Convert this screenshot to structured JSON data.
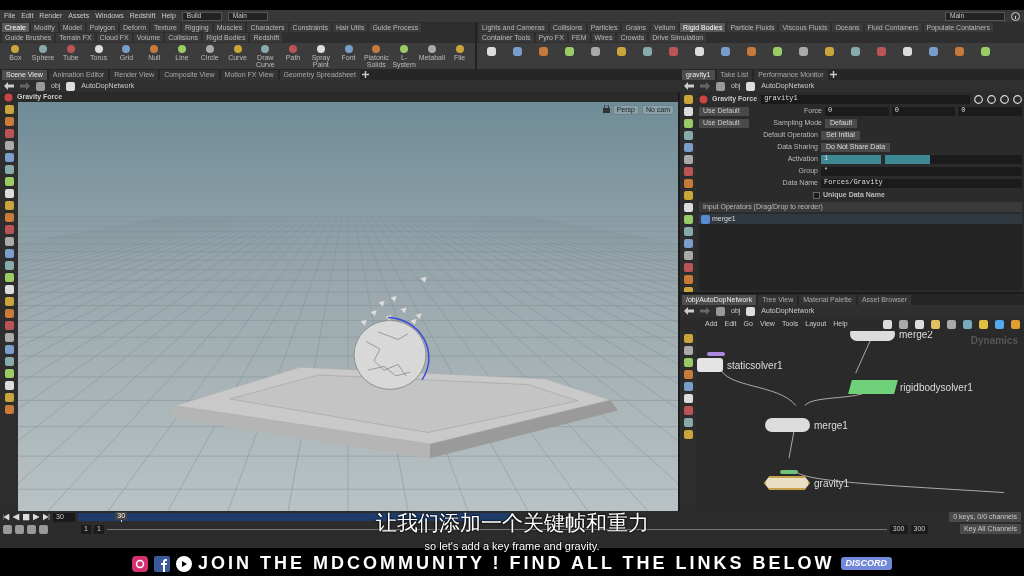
{
  "menu": [
    "File",
    "Edit",
    "Render",
    "Assets",
    "Windows",
    "Redshift",
    "Help"
  ],
  "desktop": "Build",
  "workspace": "Main",
  "main_field": "Main",
  "shelf_left": {
    "tabs": [
      {
        "label": "Create",
        "selected": true
      },
      {
        "label": "Modify",
        "selected": false
      },
      {
        "label": "Model",
        "selected": false
      },
      {
        "label": "Polygon",
        "selected": false
      },
      {
        "label": "Deform",
        "selected": false
      },
      {
        "label": "Texture",
        "selected": false
      },
      {
        "label": "Rigging",
        "selected": false
      },
      {
        "label": "Muscles",
        "selected": false
      },
      {
        "label": "Characters",
        "selected": false
      },
      {
        "label": "Constraints",
        "selected": false
      },
      {
        "label": "Hair Utils",
        "selected": false
      },
      {
        "label": "Guide Process",
        "selected": false
      },
      {
        "label": "Guide Brushes",
        "selected": false
      },
      {
        "label": "Terrain FX",
        "selected": false
      },
      {
        "label": "Cloud FX",
        "selected": false
      },
      {
        "label": "Volume",
        "selected": false
      },
      {
        "label": "Collisions",
        "selected": false
      },
      {
        "label": "Rigid Bodies",
        "selected": false
      },
      {
        "label": "Redshift",
        "selected": false
      }
    ],
    "tools": [
      "Box",
      "Sphere",
      "Tube",
      "Torus",
      "Grid",
      "Null",
      "Line",
      "Circle",
      "Curve",
      "Draw Curve",
      "Path",
      "Spray Paint",
      "Font",
      "Platonic Solids",
      "L-System",
      "Metaball",
      "File"
    ]
  },
  "shelf_right": {
    "tabs": [
      {
        "label": "Lights and Cameras",
        "selected": false
      },
      {
        "label": "Collisions",
        "selected": false
      },
      {
        "label": "Particles",
        "selected": false
      },
      {
        "label": "Grains",
        "selected": false
      },
      {
        "label": "Vellum",
        "selected": false
      },
      {
        "label": "Rigid Bodies",
        "selected": true
      },
      {
        "label": "Particle Fluids",
        "selected": false
      },
      {
        "label": "Viscous Fluids",
        "selected": false
      },
      {
        "label": "Oceans",
        "selected": false
      },
      {
        "label": "Fluid Containers",
        "selected": false
      },
      {
        "label": "Populate Containers",
        "selected": false
      },
      {
        "label": "Container Tools",
        "selected": false
      },
      {
        "label": "Pyro FX",
        "selected": false
      },
      {
        "label": "FEM",
        "selected": false
      },
      {
        "label": "Wires",
        "selected": false
      },
      {
        "label": "Crowds",
        "selected": false
      },
      {
        "label": "Drive Simulation",
        "selected": false
      }
    ]
  },
  "pane_tabs_left": [
    {
      "label": "Scene View",
      "selected": true
    },
    {
      "label": "Animation Editor",
      "selected": false
    },
    {
      "label": "Render View",
      "selected": false
    },
    {
      "label": "Composite View",
      "selected": false
    },
    {
      "label": "Motion FX View",
      "selected": false
    },
    {
      "label": "Geometry Spreadsheet",
      "selected": false
    }
  ],
  "pane_tabs_right": [
    {
      "label": "gravity1",
      "selected": true
    },
    {
      "label": "Take List",
      "selected": false
    },
    {
      "label": "Performance Monitor",
      "selected": false
    }
  ],
  "path_left": [
    "obj",
    "AutoDopNetwork"
  ],
  "path_right": [
    "obj",
    "AutoDopNetwork"
  ],
  "viewport": {
    "title": "Gravity Force",
    "camera_buttons": [
      "Persp",
      "No cam"
    ]
  },
  "parameters": {
    "node_type": "Gravity Force",
    "node_name": "gravity1",
    "rows": [
      {
        "kind": "vector",
        "default_button": "Use Default",
        "label": "Force",
        "values": [
          "0",
          "0",
          "0"
        ]
      },
      {
        "kind": "menu",
        "default_button": "Use Default",
        "label": "Sampling Mode",
        "value": "Default"
      },
      {
        "kind": "menu",
        "label": "Default Operation",
        "value": "Set Initial"
      },
      {
        "kind": "menu",
        "label": "Data Sharing",
        "value": "Do Not Share Data"
      },
      {
        "kind": "slider",
        "label": "Activation",
        "value": "1",
        "level": 0.33
      },
      {
        "kind": "text",
        "label": "Group",
        "value": "*"
      },
      {
        "kind": "text",
        "label": "Data Name",
        "value": "Forces/Gravity"
      },
      {
        "kind": "checkbox",
        "label": "Unique Data Name",
        "checked": false
      }
    ],
    "input_header": "Input Operators (Drag/Drop to reorder)",
    "inputs": [
      "merge1"
    ]
  },
  "network": {
    "tabs": [
      {
        "label": "/obj/AutoDopNetwork",
        "selected": true
      },
      {
        "label": "Tree View",
        "selected": false
      },
      {
        "label": "Material Palette",
        "selected": false
      },
      {
        "label": "Asset Browser",
        "selected": false
      }
    ],
    "path": [
      "obj",
      "AutoDopNetwork"
    ],
    "menu": [
      "Add",
      "Edit",
      "Go",
      "View",
      "Tools",
      "Layout",
      "Help"
    ],
    "context_label": "Dynamics",
    "nodes": [
      {
        "name": "merge2",
        "kind": "merge",
        "selected": false
      },
      {
        "name": "staticsolver1",
        "kind": "solver",
        "selected": false
      },
      {
        "name": "rigidbodysolver1",
        "kind": "rbd",
        "selected": false
      },
      {
        "name": "merge1",
        "kind": "merge",
        "selected": false
      },
      {
        "name": "gravity1",
        "kind": "force",
        "selected": true
      }
    ]
  },
  "timeline": {
    "frame": "30",
    "marker": "30",
    "level": 0.1,
    "start": "1",
    "start_field": "1",
    "end_field": "300",
    "end": "300",
    "keys_info": "0 keys, 0/0 channels",
    "key_button": "Key All Channels"
  },
  "subtitle": {
    "chinese": "让我们添加一个关键帧和重力",
    "english": "so let's add a key frame and gravity."
  },
  "banner": {
    "text": "JOIN THE MDCOMMUNITY ! FIND ALL THE LINKS BELOW",
    "badge": "DISCORD"
  }
}
